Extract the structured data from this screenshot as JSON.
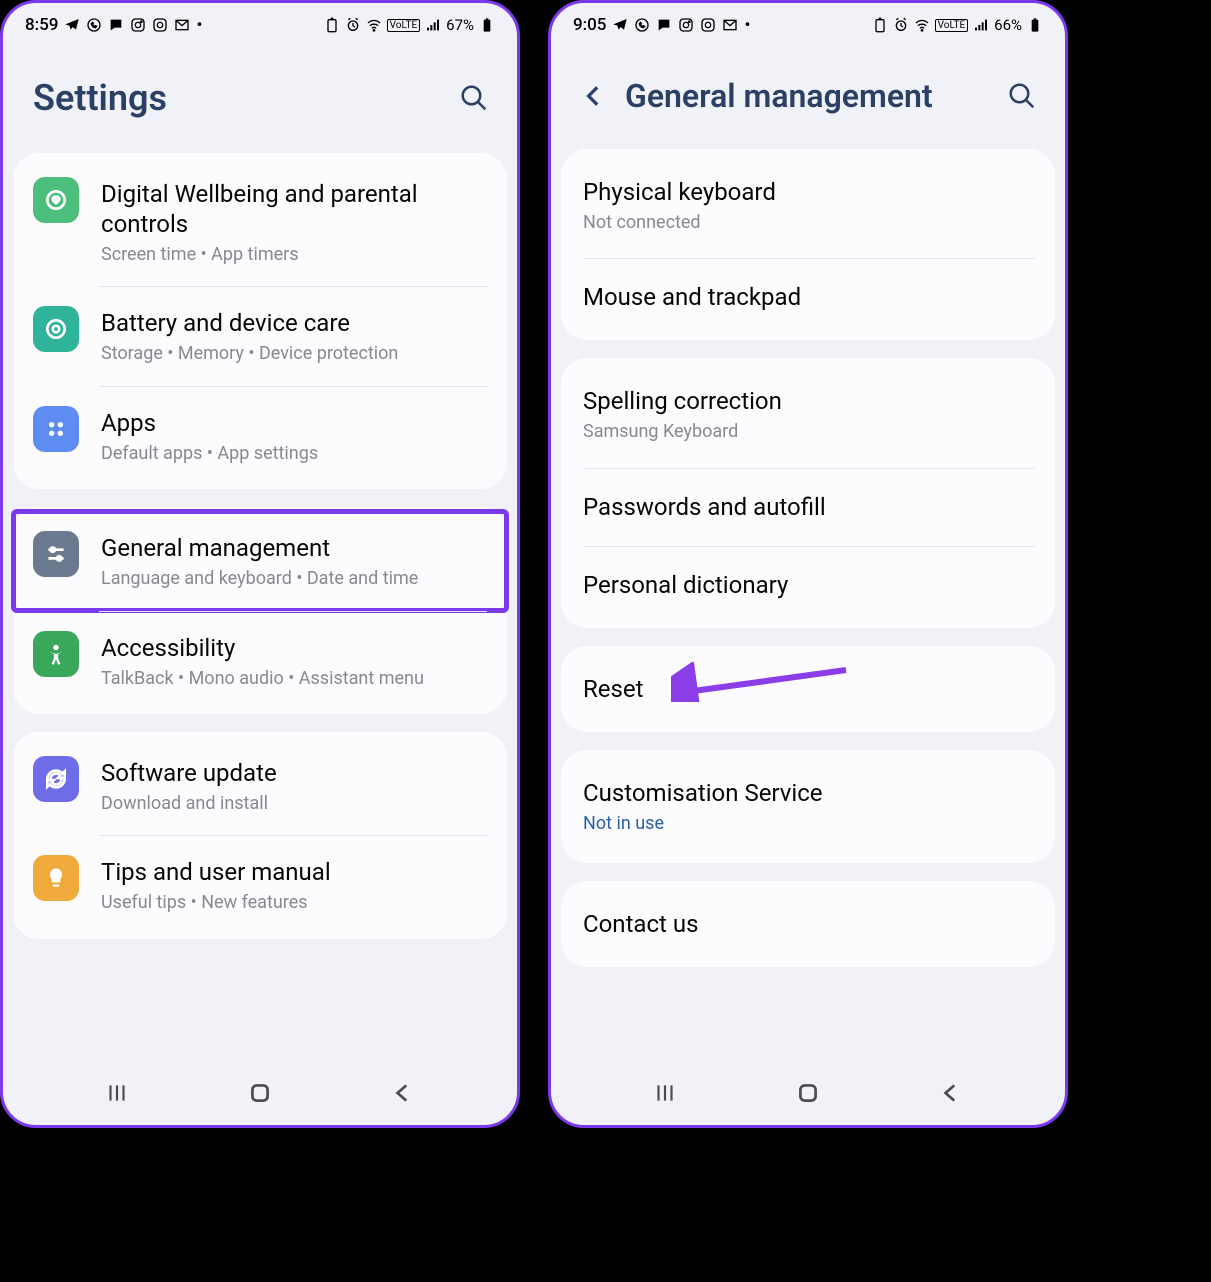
{
  "left": {
    "status": {
      "time": "8:59",
      "battery": "67%"
    },
    "header": {
      "title": "Settings"
    },
    "groups": [
      {
        "items": [
          {
            "label": "Digital Wellbeing and parental controls",
            "sub": "Screen time  •  App timers",
            "icon": "heart-icon",
            "bg": "bg-green"
          },
          {
            "label": "Battery and device care",
            "sub": "Storage  •  Memory  •  Device protection",
            "icon": "target-icon",
            "bg": "bg-teal"
          },
          {
            "label": "Apps",
            "sub": "Default apps  •  App settings",
            "icon": "grid-icon",
            "bg": "bg-blue"
          }
        ]
      },
      {
        "items": [
          {
            "label": "General management",
            "sub": "Language and keyboard  •  Date and time",
            "icon": "sliders-icon",
            "bg": "bg-slate",
            "highlight": true
          },
          {
            "label": "Accessibility",
            "sub": "TalkBack  •  Mono audio  •  Assistant menu",
            "icon": "person-icon",
            "bg": "bg-green2"
          }
        ]
      },
      {
        "items": [
          {
            "label": "Software update",
            "sub": "Download and install",
            "icon": "refresh-icon",
            "bg": "bg-indigo"
          },
          {
            "label": "Tips and user manual",
            "sub": "Useful tips  •  New features",
            "icon": "bulb-icon",
            "bg": "bg-orange"
          }
        ]
      }
    ]
  },
  "right": {
    "status": {
      "time": "9:05",
      "battery": "66%"
    },
    "header": {
      "title": "General management"
    },
    "groups": [
      {
        "items": [
          {
            "label": "Physical keyboard",
            "sub": "Not connected"
          },
          {
            "label": "Mouse and trackpad"
          }
        ]
      },
      {
        "items": [
          {
            "label": "Spelling correction",
            "sub": "Samsung Keyboard"
          },
          {
            "label": "Passwords and autofill"
          },
          {
            "label": "Personal dictionary"
          }
        ]
      },
      {
        "items": [
          {
            "label": "Reset",
            "arrow": true
          }
        ]
      },
      {
        "items": [
          {
            "label": "Customisation Service",
            "sub": "Not in use",
            "sublink": true
          }
        ]
      },
      {
        "items": [
          {
            "label": "Contact us"
          }
        ]
      }
    ]
  }
}
